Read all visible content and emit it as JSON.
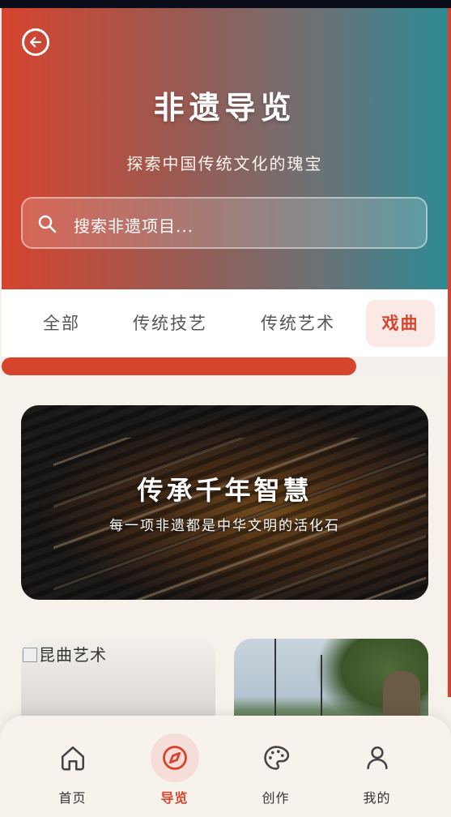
{
  "header": {
    "title": "非遗导览",
    "subtitle": "探索中国传统文化的瑰宝",
    "search_placeholder": "搜索非遗项目..."
  },
  "tabs": [
    {
      "label": "全部"
    },
    {
      "label": "传统技艺"
    },
    {
      "label": "传统艺术"
    },
    {
      "label": "戏曲"
    }
  ],
  "banner": {
    "title": "传承千年智慧",
    "subtitle": "每一项非遗都是中华文明的活化石"
  },
  "cards": [
    {
      "alt": "昆曲艺术"
    }
  ],
  "nav": [
    {
      "label": "首页",
      "icon": "home-icon"
    },
    {
      "label": "导览",
      "icon": "compass-icon"
    },
    {
      "label": "创作",
      "icon": "palette-icon"
    },
    {
      "label": "我的",
      "icon": "user-icon"
    }
  ],
  "colors": {
    "accent": "#d5452e",
    "gradient_start": "#d6432e",
    "gradient_end": "#2f8a96"
  }
}
